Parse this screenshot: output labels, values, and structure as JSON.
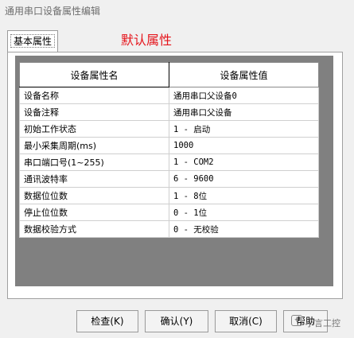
{
  "window": {
    "title": "通用串口设备属性编辑"
  },
  "tab": {
    "label": "基本属性",
    "heading": "默认属性"
  },
  "table": {
    "headers": [
      "设备属性名",
      "设备属性值"
    ],
    "rows": [
      [
        "设备名称",
        "通用串口父设备0"
      ],
      [
        "设备注释",
        "通用串口父设备"
      ],
      [
        "初始工作状态",
        "1 - 启动"
      ],
      [
        "最小采集周期(ms)",
        "1000"
      ],
      [
        "串口端口号(1~255)",
        "1 - COM2"
      ],
      [
        "通讯波特率",
        "6 - 9600"
      ],
      [
        "数据位位数",
        "1 - 8位"
      ],
      [
        "停止位位数",
        "0 - 1位"
      ],
      [
        "数据校验方式",
        "0 - 无校验"
      ]
    ]
  },
  "buttons": {
    "check": "检查(K)",
    "ok": "确认(Y)",
    "cancel": "取消(C)",
    "help": "帮助"
  },
  "watermark": "小言工控"
}
